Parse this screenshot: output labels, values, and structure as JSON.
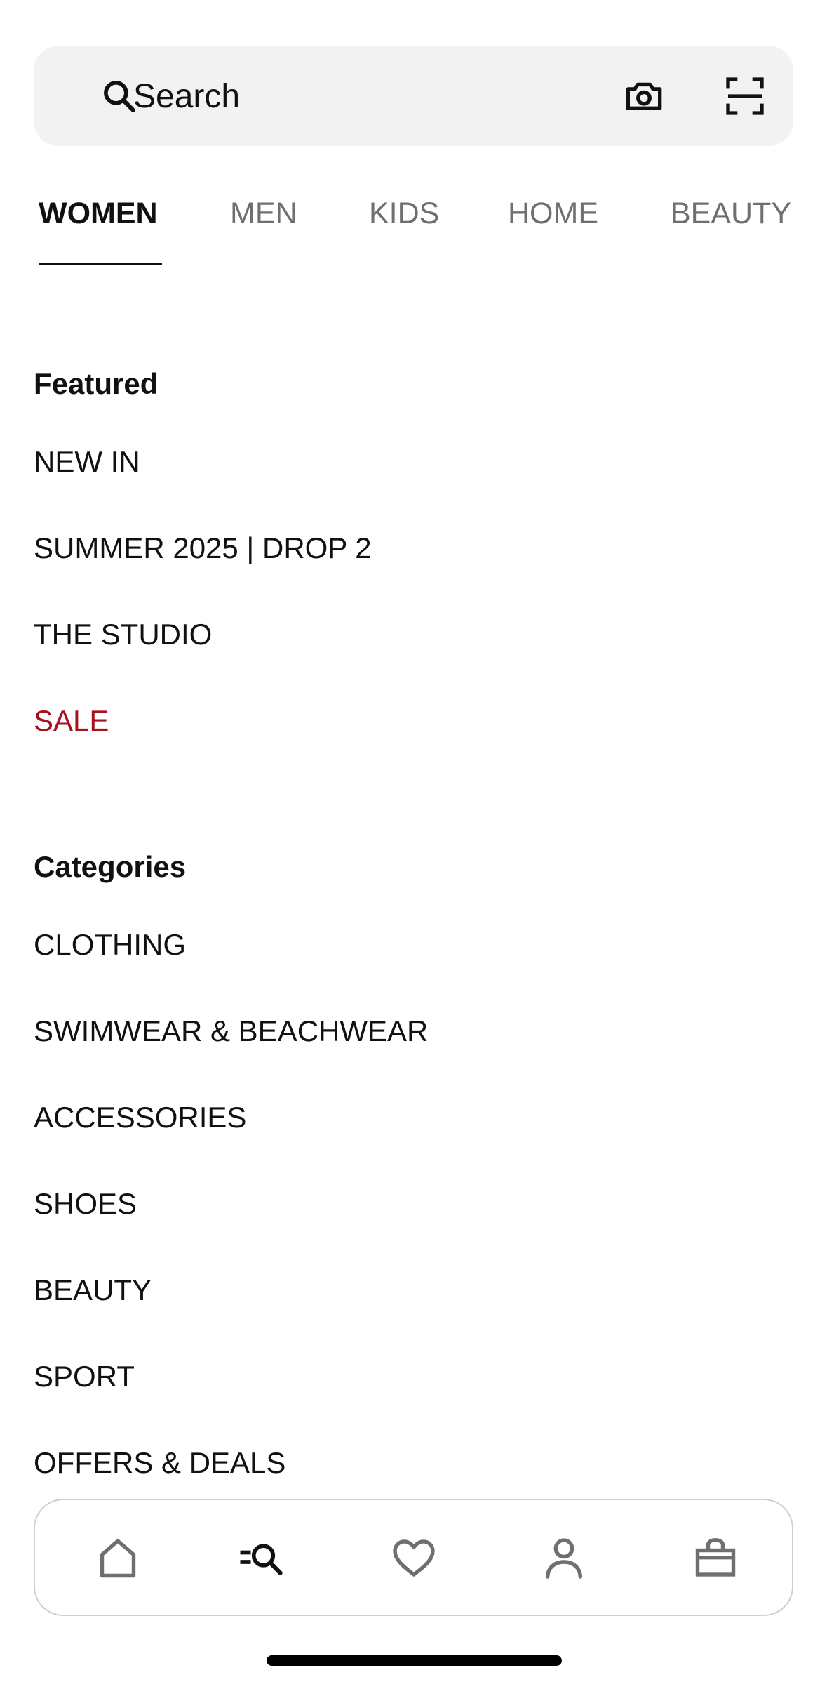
{
  "search": {
    "placeholder": "Search"
  },
  "tabs": [
    {
      "label": "WOMEN",
      "active": true
    },
    {
      "label": "MEN",
      "active": false
    },
    {
      "label": "KIDS",
      "active": false
    },
    {
      "label": "HOME",
      "active": false
    },
    {
      "label": "BEAUTY",
      "active": false
    }
  ],
  "featured": {
    "title": "Featured",
    "items": [
      "NEW IN",
      "SUMMER 2025 | DROP 2",
      "THE STUDIO",
      "SALE"
    ]
  },
  "categories": {
    "title": "Categories",
    "items": [
      "CLOTHING",
      "SWIMWEAR & BEACHWEAR",
      "ACCESSORIES",
      "SHOES",
      "BEAUTY",
      "SPORT",
      "OFFERS & DEALS"
    ]
  },
  "bottom_nav": {
    "items": [
      "home-icon",
      "browse-search-icon",
      "heart-icon",
      "user-icon",
      "shopping-bag-icon"
    ]
  },
  "colors": {
    "sale": "#a8101e",
    "search_bg": "#f2f2f2",
    "inactive_tab": "#6f6f6f"
  }
}
